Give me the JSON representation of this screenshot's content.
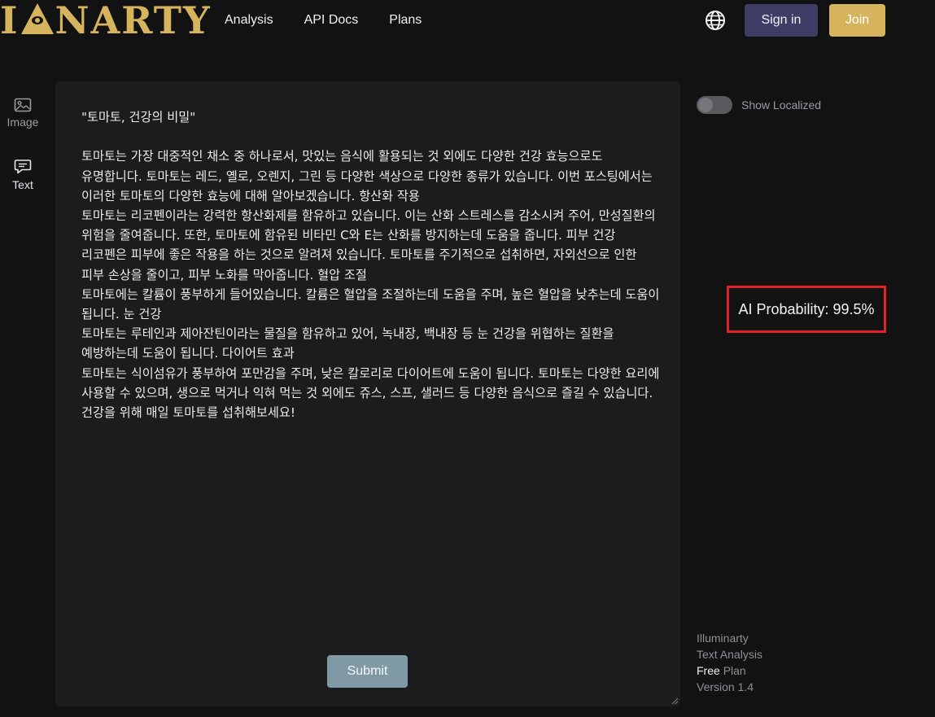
{
  "header": {
    "logo_text_left": "I",
    "logo_text_right": "NARTY",
    "nav": [
      "Analysis",
      "API Docs",
      "Plans"
    ],
    "sign_in_label": "Sign in",
    "join_label": "Join"
  },
  "sidebar": {
    "items": [
      {
        "label": "Image",
        "icon": "image-icon"
      },
      {
        "label": "Text",
        "icon": "chat-bubble-icon"
      }
    ]
  },
  "editor": {
    "content": "\"토마토, 건강의 비밀\"\n\n토마토는 가장 대중적인 채소 중 하나로서, 맛있는 음식에 활용되는 것 외에도 다양한 건강 효능으로도 유명합니다. 토마토는 레드, 옐로, 오렌지, 그린 등 다양한 색상으로 다양한 종류가 있습니다. 이번 포스팅에서는 이러한 토마토의 다양한 효능에 대해 알아보겠습니다. 항산화 작용\n토마토는 리코펜이라는 강력한 항산화제를 함유하고 있습니다. 이는 산화 스트레스를 감소시켜 주어, 만성질환의 위험을 줄여줍니다. 또한, 토마토에 함유된 비타민 C와 E는 산화를 방지하는데 도움을 줍니다. 피부 건강\n리코펜은 피부에 좋은 작용을 하는 것으로 알려져 있습니다. 토마토를 주기적으로 섭취하면, 자외선으로 인한 피부 손상을 줄이고, 피부 노화를 막아줍니다. 혈압 조절\n토마토에는 칼륨이 풍부하게 들어있습니다. 칼륨은 혈압을 조절하는데 도움을 주며, 높은 혈압을 낮추는데 도움이 됩니다. 눈 건강\n토마토는 루테인과 제아잔틴이라는 물질을 함유하고 있어, 녹내장, 백내장 등 눈 건강을 위협하는 질환을 예방하는데 도움이 됩니다. 다이어트 효과\n토마토는 식이섬유가 풍부하여 포만감을 주며, 낮은 칼로리로 다이어트에 도움이 됩니다. 토마토는 다양한 요리에 사용할 수 있으며, 생으로 먹거나 익혀 먹는 것 외에도 쥬스, 스프, 샐러드 등 다양한 음식으로 즐길 수 있습니다. 건강을 위해 매일 토마토를 섭취해보세요!",
    "submit_label": "Submit"
  },
  "right_panel": {
    "toggle_label": "Show Localized",
    "toggle_on": false,
    "result_label": "AI Probability: 99.5%",
    "highlight_color": "#e0222b"
  },
  "footer": {
    "line1": "Illuminarty",
    "line2": "Text Analysis",
    "plan_name": "Free",
    "plan_suffix": "Plan",
    "version": "Version 1.4"
  },
  "colors": {
    "brand_gold": "#d6b35d",
    "sign_in_bg": "#3d3d66",
    "submit_bg": "#7f9aa5",
    "background": "#121213",
    "panel": "#1c1c1f"
  }
}
